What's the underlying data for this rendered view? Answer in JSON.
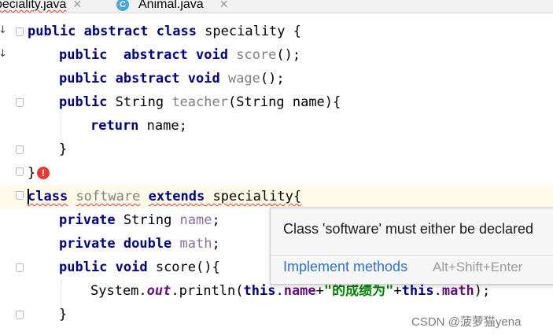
{
  "tabs": [
    {
      "label": "peciality.java",
      "close": "✕"
    },
    {
      "icon_letter": "C",
      "label": "Animal.java",
      "close": "✕"
    }
  ],
  "code": {
    "l1": {
      "kw": "public abstract class",
      "rest": " speciality {"
    },
    "l2": {
      "kw1": "public",
      "kw2": "abstract void",
      "method": "score",
      "rest": "();"
    },
    "l3": {
      "kw": "public abstract void",
      "method": "wage",
      "rest": "();"
    },
    "l4": {
      "kw": "public",
      "type": " String ",
      "method": "teacher",
      "rest": "(String name){"
    },
    "l5": {
      "kw": "return",
      "rest": " name;"
    },
    "l6": {
      "text": "}"
    },
    "l7": {
      "text": "}"
    },
    "l8": {
      "kw1": "class",
      "name": "software",
      "kw2": "extends",
      "rest": " speciality{"
    },
    "l9": {
      "kw": "private",
      "type": " String ",
      "field": "name",
      "rest": ";"
    },
    "l10": {
      "kw": "private double",
      "field": "math",
      "rest": ";"
    },
    "l11": {
      "kw": "public void",
      "rest": " score(){"
    },
    "l12": {
      "pre": "System.",
      "out": "out",
      "mid": ".println(",
      "kw1": "this",
      "dot1": ".",
      "f1": "name",
      "plus1": "+",
      "str": "\"的成绩为\"",
      "plus2": "+",
      "kw2": "this",
      "dot2": ".",
      "f2": "math",
      "end": ");"
    },
    "l13": {
      "text": "}"
    }
  },
  "popup": {
    "message": "Class 'software' must either be declared",
    "action": "Implement methods",
    "shortcut": "Alt+Shift+Enter"
  },
  "gutter": {
    "arrow_glyph": "↓"
  },
  "error_icon_glyph": "!",
  "watermark": "CSDN @菠萝猫yena"
}
